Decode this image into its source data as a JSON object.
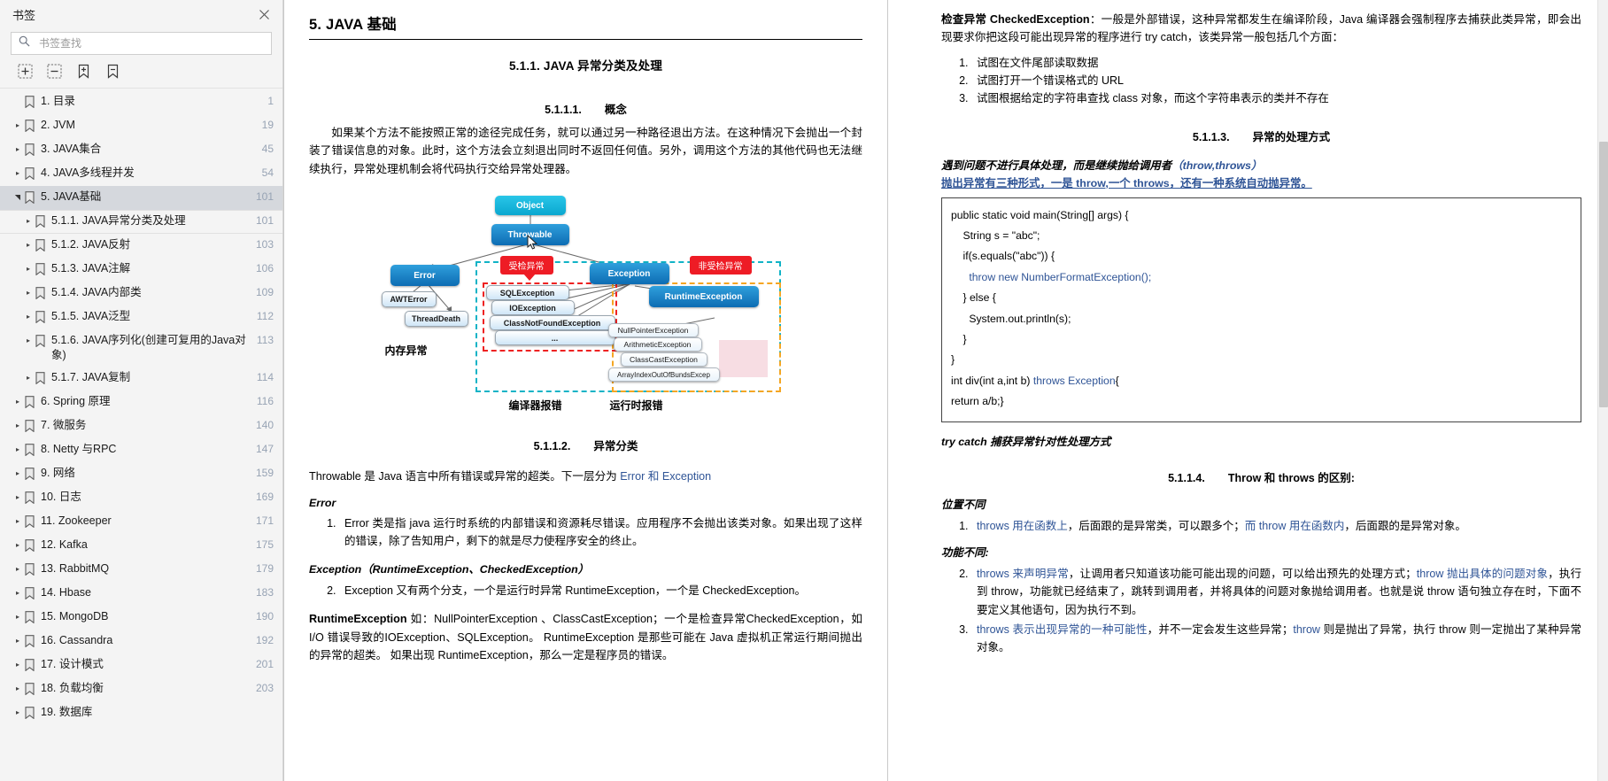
{
  "sidebar": {
    "title": "书签",
    "close_icon": "close-icon",
    "search": {
      "placeholder": "书签查找",
      "value": "",
      "icon": "search-icon"
    },
    "toolbar": [
      {
        "name": "expand-all-button",
        "icon": "expand-all-icon"
      },
      {
        "name": "collapse-all-button",
        "icon": "collapse-all-icon"
      },
      {
        "name": "add-bookmark-button",
        "icon": "add-bookmark-icon"
      },
      {
        "name": "remove-bookmark-button",
        "icon": "remove-bookmark-icon"
      }
    ],
    "items": [
      {
        "label": "1. 目录",
        "page": "1",
        "level": 0,
        "arrow": "none",
        "selected": false
      },
      {
        "label": "2. JVM",
        "page": "19",
        "level": 0,
        "arrow": "collapsed",
        "selected": false
      },
      {
        "label": "3. JAVA集合",
        "page": "45",
        "level": 0,
        "arrow": "collapsed",
        "selected": false
      },
      {
        "label": "4. JAVA多线程并发",
        "page": "54",
        "level": 0,
        "arrow": "collapsed",
        "selected": false
      },
      {
        "label": "5. JAVA基础",
        "page": "101",
        "level": 0,
        "arrow": "expanded",
        "selected": true
      },
      {
        "label": "5.1.1. JAVA异常分类及处理",
        "page": "101",
        "level": 1,
        "arrow": "collapsed",
        "selected": false,
        "subsel": true
      },
      {
        "label": "5.1.2. JAVA反射",
        "page": "103",
        "level": 1,
        "arrow": "collapsed",
        "selected": false
      },
      {
        "label": "5.1.3. JAVA注解",
        "page": "106",
        "level": 1,
        "arrow": "collapsed",
        "selected": false
      },
      {
        "label": "5.1.4. JAVA内部类",
        "page": "109",
        "level": 1,
        "arrow": "collapsed",
        "selected": false
      },
      {
        "label": "5.1.5. JAVA泛型",
        "page": "112",
        "level": 1,
        "arrow": "collapsed",
        "selected": false
      },
      {
        "label": "5.1.6. JAVA序列化(创建可复用的Java对象)",
        "page": "113",
        "level": 1,
        "arrow": "collapsed",
        "selected": false
      },
      {
        "label": "5.1.7. JAVA复制",
        "page": "114",
        "level": 1,
        "arrow": "collapsed",
        "selected": false
      },
      {
        "label": "6. Spring 原理",
        "page": "116",
        "level": 0,
        "arrow": "collapsed",
        "selected": false
      },
      {
        "label": "7.   微服务",
        "page": "140",
        "level": 0,
        "arrow": "collapsed",
        "selected": false
      },
      {
        "label": "8. Netty 与RPC",
        "page": "147",
        "level": 0,
        "arrow": "collapsed",
        "selected": false
      },
      {
        "label": "9. 网络",
        "page": "159",
        "level": 0,
        "arrow": "collapsed",
        "selected": false
      },
      {
        "label": "10. 日志",
        "page": "169",
        "level": 0,
        "arrow": "collapsed",
        "selected": false
      },
      {
        "label": "11. Zookeeper",
        "page": "171",
        "level": 0,
        "arrow": "collapsed",
        "selected": false
      },
      {
        "label": "12. Kafka",
        "page": "175",
        "level": 0,
        "arrow": "collapsed",
        "selected": false
      },
      {
        "label": "13. RabbitMQ",
        "page": "179",
        "level": 0,
        "arrow": "collapsed",
        "selected": false
      },
      {
        "label": "14. Hbase",
        "page": "183",
        "level": 0,
        "arrow": "collapsed",
        "selected": false
      },
      {
        "label": "15. MongoDB",
        "page": "190",
        "level": 0,
        "arrow": "collapsed",
        "selected": false
      },
      {
        "label": "16. Cassandra",
        "page": "192",
        "level": 0,
        "arrow": "collapsed",
        "selected": false
      },
      {
        "label": "17. 设计模式",
        "page": "201",
        "level": 0,
        "arrow": "collapsed",
        "selected": false
      },
      {
        "label": "18. 负载均衡",
        "page": "203",
        "level": 0,
        "arrow": "collapsed",
        "selected": false
      },
      {
        "label": "19. 数据库",
        "page": "",
        "level": 0,
        "arrow": "collapsed",
        "selected": false
      }
    ]
  },
  "doc": {
    "mid": {
      "h1": "5. JAVA 基础",
      "h2": "5.1.1.  JAVA 异常分类及处理",
      "h3_1_num": "5.1.1.1.",
      "h3_1_text": "概念",
      "p1": "如果某个方法不能按照正常的途径完成任务，就可以通过另一种路径退出方法。在这种情况下会抛出一个封装了错误信息的对象。此时，这个方法会立刻退出同时不返回任何值。另外，调用这个方法的其他代码也无法继续执行，异常处理机制会将代码执行交给异常处理器。",
      "h3_2_num": "5.1.1.2.",
      "h3_2_text": "异常分类",
      "p2_pre": "Throwable 是 Java 语言中所有错误或异常的超类。下一层分为 ",
      "p2_link": "Error 和 Exception",
      "err_head": "Error",
      "li1": "Error 类是指 java 运行时系统的内部错误和资源耗尽错误。应用程序不会抛出该类对象。如果出现了这样的错误，除了告知用户，剩下的就是尽力使程序安全的终止。",
      "exc_head": "Exception",
      "exc_head_paren": "（RuntimeException、CheckedException）",
      "li2": "Exception 又有两个分支，一个是运行时异常 RuntimeException，一个是 CheckedException。",
      "p3_bold": "RuntimeException",
      "p3_rest": " 如：NullPointerException 、ClassCastException；一个是检查异常CheckedException，如 I/O 错误导致的IOException、SQLException。 RuntimeException 是那些可能在 Java 虚拟机正常运行期间抛出的异常的超类。 如果出现 RuntimeException，那么一定是程序员的错误。"
    },
    "diagram": {
      "name": "java-exception-hierarchy-diagram",
      "nodes": {
        "object": "Object",
        "throwable": "Throwable",
        "error": "Error",
        "exception": "Exception",
        "awterror": "AWTError",
        "threaddeath": "ThreadDeath",
        "runtime": "RuntimeException",
        "sql": "SQLException",
        "io": "IOException",
        "cnf": "ClassNotFoundException",
        "ellipsis": "...",
        "npe": "NullPointerException",
        "arith": "ArithmeticException",
        "ccast": "ClassCastException",
        "aioobe": "ArrayIndexOutOfBundsExcep"
      },
      "badges": {
        "checked": "受检异常",
        "unchecked": "非受检异常"
      },
      "captions": {
        "memory": "内存异常",
        "compile": "编译器报错",
        "runtime": "运行时报错"
      }
    },
    "right": {
      "p_checked_bold": "检查异常 CheckedException",
      "p_checked_rest": "：一般是外部错误，这种异常都发生在编译阶段，Java 编译器会强制程序去捕获此类异常，即会出现要求你把这段可能出现异常的程序进行 try catch，该类异常一般包括几个方面：",
      "ol_checked": [
        "试图在文件尾部读取数据",
        "试图打开一个错误格式的 URL",
        "试图根据给定的字符串查找 class 对象，而这个字符串表示的类并不存在"
      ],
      "h3_3_num": "5.1.1.3.",
      "h3_3_text": "异常的处理方式",
      "em1_a": "遇到问题不进行具体处理，而是继续抛给调用者",
      "em1_b": "（throw,throws）",
      "em2": "抛出异常有三种形式，一是 throw,一个 throws，还有一种系统自动抛异常。",
      "code": [
        {
          "text": "public static void main(String[] args) {",
          "kw": ""
        },
        {
          "text": "    String s = \"abc\";",
          "kw": ""
        },
        {
          "text": "    if(s.equals(\"abc\")) {",
          "kw": ""
        },
        {
          "text": "      throw new NumberFormatException();",
          "kw": "all"
        },
        {
          "text": "    } else {",
          "kw": ""
        },
        {
          "text": "      System.out.println(s);",
          "kw": ""
        },
        {
          "text": "    }",
          "kw": ""
        },
        {
          "text": "}",
          "kw": ""
        },
        {
          "text": "int div(int a,int b) throws Exception{",
          "kw": "split"
        },
        {
          "text": "return a/b;}",
          "kw": ""
        }
      ],
      "code_split_plain": "int div(int a,int b) ",
      "code_split_kw": "throws Exception",
      "code_split_tail": "{",
      "em3": "try catch 捕获异常针对性处理方式",
      "h3_4_num": "5.1.1.4.",
      "h3_4_text": "Throw 和 throws 的区别:",
      "em4": "位置不同",
      "li_pos_1a": "throws 用在函数上",
      "li_pos_1b": "，后面跟的是异常类，可以跟多个；",
      "li_pos_1c": "而 throw 用在函数内",
      "li_pos_1d": "，后面跟的是异常对象。",
      "em5": "功能不同:",
      "li_fn_2a": "throws 来声明异常",
      "li_fn_2b": "，让调用者只知道该功能可能出现的问题，可以给出预先的处理方式；",
      "li_fn_2c": "throw 抛出具体的问题对象",
      "li_fn_2d": "，执行到 throw，功能就已经结束了，跳转到调用者，并将具体的问题对象抛给调用者。也就是说 throw 语句独立存在时，下面不要定义其他语句，因为执行不到。",
      "li_fn_3a": "throws 表示出现异常的一种可能性",
      "li_fn_3b": "，并不一定会发生这些异常；",
      "li_fn_3c": "throw",
      "li_fn_3d": " 则是抛出了异常，执行 throw 则一定抛出了某种异常对象。"
    }
  },
  "colors": {
    "accent_blue": "#2f5496",
    "node_blue": "#0d6cb3",
    "node_cyan": "#0aa7cf",
    "badge_red": "#ee1c25",
    "dash_teal": "#11b3c6",
    "dash_orange": "#f5a623",
    "selection_gray": "#d5d8dd",
    "page_num_gray": "#97a3b4"
  }
}
